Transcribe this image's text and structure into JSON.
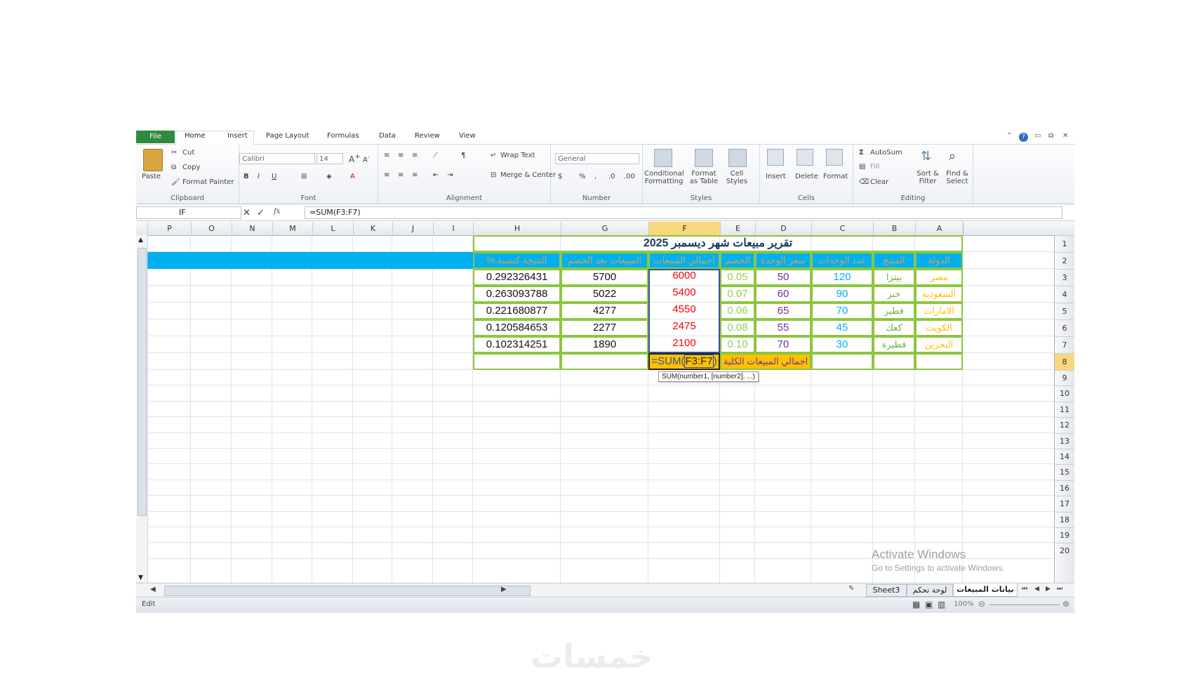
{
  "ribbon": {
    "tabs": [
      "File",
      "Home",
      "Insert",
      "Page Layout",
      "Formulas",
      "Data",
      "Review",
      "View"
    ],
    "clipboard": {
      "paste": "Paste",
      "cut": "Cut",
      "copy": "Copy",
      "format_painter": "Format Painter",
      "label": "Clipboard"
    },
    "font": {
      "name": "Calibri",
      "size": "14",
      "label": "Font"
    },
    "alignment": {
      "wrap": "Wrap Text",
      "merge": "Merge & Center",
      "label": "Alignment"
    },
    "number": {
      "format": "General",
      "label": "Number"
    },
    "styles": {
      "conditional": "Conditional Formatting",
      "format_table": "Format as Table",
      "cell_styles": "Cell Styles",
      "label": "Styles"
    },
    "cells": {
      "insert": "Insert",
      "delete": "Delete",
      "format": "Format",
      "label": "Cells"
    },
    "editing": {
      "autosum": "AutoSum",
      "fill": "Fill",
      "clear": "Clear",
      "sort": "Sort & Filter",
      "find": "Find & Select",
      "label": "Editing"
    }
  },
  "formula_bar": {
    "name_box": "IF",
    "formula": "=SUM(F3:F7)"
  },
  "columns": [
    "P",
    "O",
    "N",
    "M",
    "L",
    "K",
    "J",
    "I",
    "H",
    "G",
    "F",
    "E",
    "D",
    "C",
    "B",
    "A"
  ],
  "rows": [
    "1",
    "2",
    "3",
    "4",
    "5",
    "6",
    "7",
    "8",
    "9",
    "10",
    "11",
    "12",
    "13",
    "14",
    "15",
    "16",
    "17",
    "18",
    "19",
    "20"
  ],
  "sheet": {
    "title": "تقرير مبيعات شهر ديسمبر 2025",
    "headers": {
      "A": "الدولة",
      "B": "المنتج",
      "C": "عدد الوحدات",
      "D": "سعر الوحدة",
      "E": "الخصم",
      "F": "اجمالي المبيعات",
      "G": "المبيعات بعد الخصم",
      "H": "النتيجة كنسبة %"
    },
    "data": [
      {
        "A": "مصر",
        "B": "بيتزا",
        "C": "120",
        "D": "50",
        "E": "0.05",
        "F": "6000",
        "G": "5700",
        "H": "0.292326431"
      },
      {
        "A": "السعودية",
        "B": "خبز",
        "C": "90",
        "D": "60",
        "E": "0.07",
        "F": "5400",
        "G": "5022",
        "H": "0.263093788"
      },
      {
        "A": "الامارات",
        "B": "فطير",
        "C": "70",
        "D": "65",
        "E": "0.06",
        "F": "4550",
        "G": "4277",
        "H": "0.221680877"
      },
      {
        "A": "الكويت",
        "B": "كعك",
        "C": "45",
        "D": "55",
        "E": "0.08",
        "F": "2475",
        "G": "2277",
        "H": "0.120584653"
      },
      {
        "A": "البحرين",
        "B": "فطيرة",
        "C": "30",
        "D": "70",
        "E": "0.10",
        "F": "2100",
        "G": "1890",
        "H": "0.102314251"
      }
    ],
    "total_label": "اجمالي المبيعات الكلية",
    "total_formula_prefix": "=SUM(",
    "total_formula_ref": "F3:F7",
    "total_formula_suffix": ")",
    "tooltip": "SUM(number1, [number2], ...)"
  },
  "sheet_tabs": [
    "بيانات المبيعات",
    "لوحة تحكم",
    "Sheet3"
  ],
  "status": {
    "mode": "Edit",
    "zoom": "100%"
  },
  "watermark": {
    "activate": "Activate Windows",
    "goto": "Go to Settings to activate Windows."
  },
  "brand_logo": "خمسات",
  "colors": {
    "green_border": "#8dc63f",
    "blue_header": "#00b0f0",
    "selected_yellow": "#ffc000",
    "col_a": "#ffc000",
    "col_b": "#70ad47",
    "col_c": "#00b0f0",
    "col_d": "#7030a0",
    "col_e": "#92d050",
    "col_f": "#ff0000"
  }
}
